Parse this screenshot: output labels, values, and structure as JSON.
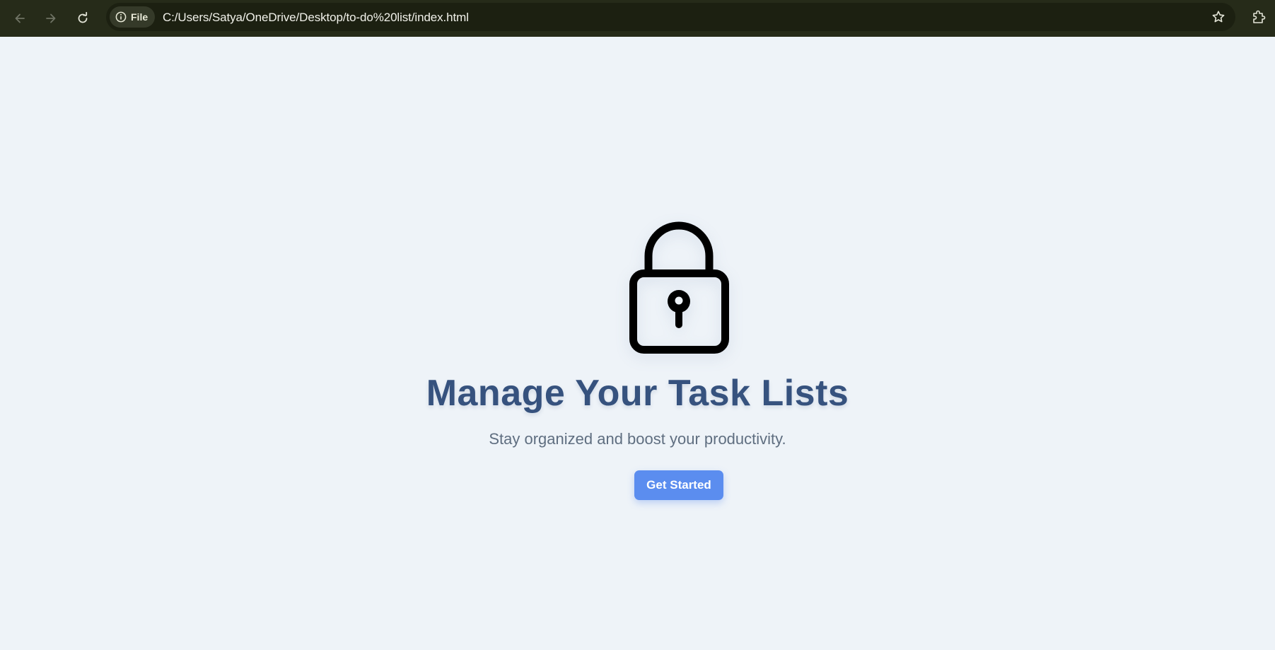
{
  "browser": {
    "site_chip_label": "File",
    "url": "C:/Users/Satya/OneDrive/Desktop/to-do%20list/index.html",
    "icons": {
      "back": "arrow-left-icon",
      "forward": "arrow-right-icon",
      "reload": "reload-icon",
      "site_info": "info-icon",
      "bookmark": "star-icon",
      "extensions": "puzzle-icon"
    }
  },
  "hero": {
    "icon": "lock-icon",
    "title": "Manage Your Task Lists",
    "subtitle": "Stay organized and boost your productivity.",
    "cta_label": "Get Started"
  },
  "colors": {
    "page_background": "#eef3f8",
    "title": "#36527e",
    "subtitle": "#5f6e80",
    "button": "#5b8def",
    "browser_bar": "#262b19"
  }
}
